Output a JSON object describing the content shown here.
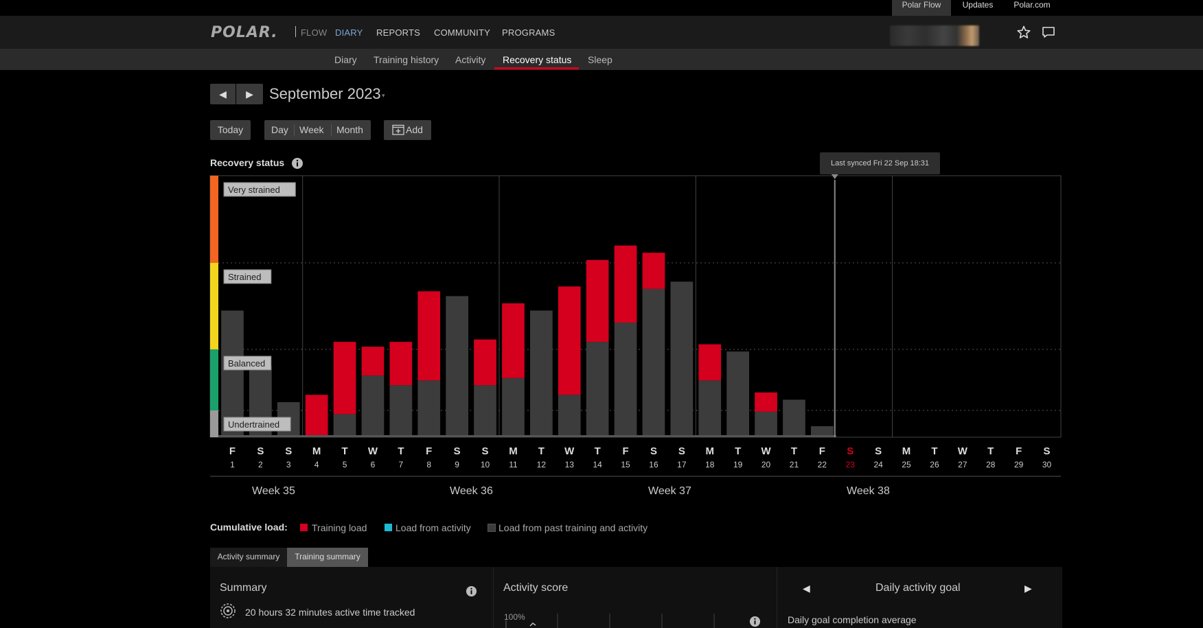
{
  "topbar": {
    "polar_flow": "Polar Flow",
    "updates": "Updates",
    "polar_com": "Polar.com"
  },
  "nav": {
    "logo": "POLAR.",
    "flow": "FLOW",
    "diary": "DIARY",
    "reports": "REPORTS",
    "community": "COMMUNITY",
    "programs": "PROGRAMS"
  },
  "icons": {
    "star": "star-icon",
    "chat": "chat-icon",
    "info": "info-icon",
    "add": "calendar-add-icon"
  },
  "subnav": {
    "diary": "Diary",
    "training_history": "Training history",
    "activity": "Activity",
    "recovery_status": "Recovery status",
    "sleep": "Sleep"
  },
  "date": {
    "prev": "◀",
    "next": "▶",
    "month": "September 2023",
    "caret": "▾"
  },
  "controls": {
    "today": "Today",
    "day": "Day",
    "week": "Week",
    "month": "Month",
    "add": "Add"
  },
  "colors": {
    "training_load": "#d4001e",
    "load_from_activity": "#1fb9d3",
    "past_load": "#3c3c3c",
    "very_strained": "#f26522",
    "strained": "#f2d51c",
    "balanced": "#1aa16b",
    "undertrained": "#9a9a9a"
  },
  "chart_data": {
    "type": "bar",
    "title": "Recovery status",
    "zones": [
      "Very strained",
      "Strained",
      "Balanced",
      "Undertrained"
    ],
    "sync_label": "Last synced Fri 22 Sep 18:31",
    "sync_day": 22,
    "weekday_labels": [
      "F",
      "S",
      "S",
      "M",
      "T",
      "W",
      "T",
      "F",
      "S",
      "S",
      "M",
      "T",
      "W",
      "T",
      "F",
      "S",
      "S",
      "M",
      "T",
      "W",
      "T",
      "F",
      "S",
      "S",
      "M",
      "T",
      "W",
      "T",
      "F",
      "S"
    ],
    "days": [
      1,
      2,
      3,
      4,
      5,
      6,
      7,
      8,
      9,
      10,
      11,
      12,
      13,
      14,
      15,
      16,
      17,
      18,
      19,
      20,
      21,
      22,
      23,
      24,
      25,
      26,
      27,
      28,
      29,
      30
    ],
    "highlight_day": 23,
    "week_labels": [
      "Week 35",
      "Week 36",
      "Week 37",
      "Week 38"
    ],
    "ylim": [
      0,
      1
    ],
    "series": [
      {
        "name": "Load from past training and activity",
        "values": [
          0.52,
          0.29,
          0.14,
          0.0,
          0.09,
          0.25,
          0.21,
          0.23,
          0.58,
          0.21,
          0.24,
          0.52,
          0.17,
          0.39,
          0.47,
          0.61,
          0.64,
          0.23,
          0.35,
          0.1,
          0.15,
          0.04,
          0,
          0,
          0,
          0,
          0,
          0,
          0,
          0
        ]
      },
      {
        "name": "Training load",
        "values": [
          0,
          0,
          0,
          0.17,
          0.3,
          0.12,
          0.18,
          0.37,
          0,
          0.19,
          0.31,
          0,
          0.45,
          0.34,
          0.32,
          0.15,
          0,
          0.15,
          0,
          0.08,
          0,
          0,
          0,
          0,
          0,
          0,
          0,
          0,
          0,
          0
        ]
      }
    ]
  },
  "legend": {
    "title": "Cumulative load:",
    "training_load": "Training load",
    "load_from_activity": "Load from activity",
    "past": "Load from past training and activity"
  },
  "tabs": {
    "activity_summary": "Activity summary",
    "training_summary": "Training summary"
  },
  "summary": {
    "title": "Summary",
    "text": "20 hours 32 minutes active time tracked"
  },
  "score": {
    "title": "Activity score",
    "pct": "100%"
  },
  "goal": {
    "prev": "◀",
    "title": "Daily activity goal",
    "next": "▶",
    "sub": "Daily goal completion average"
  }
}
